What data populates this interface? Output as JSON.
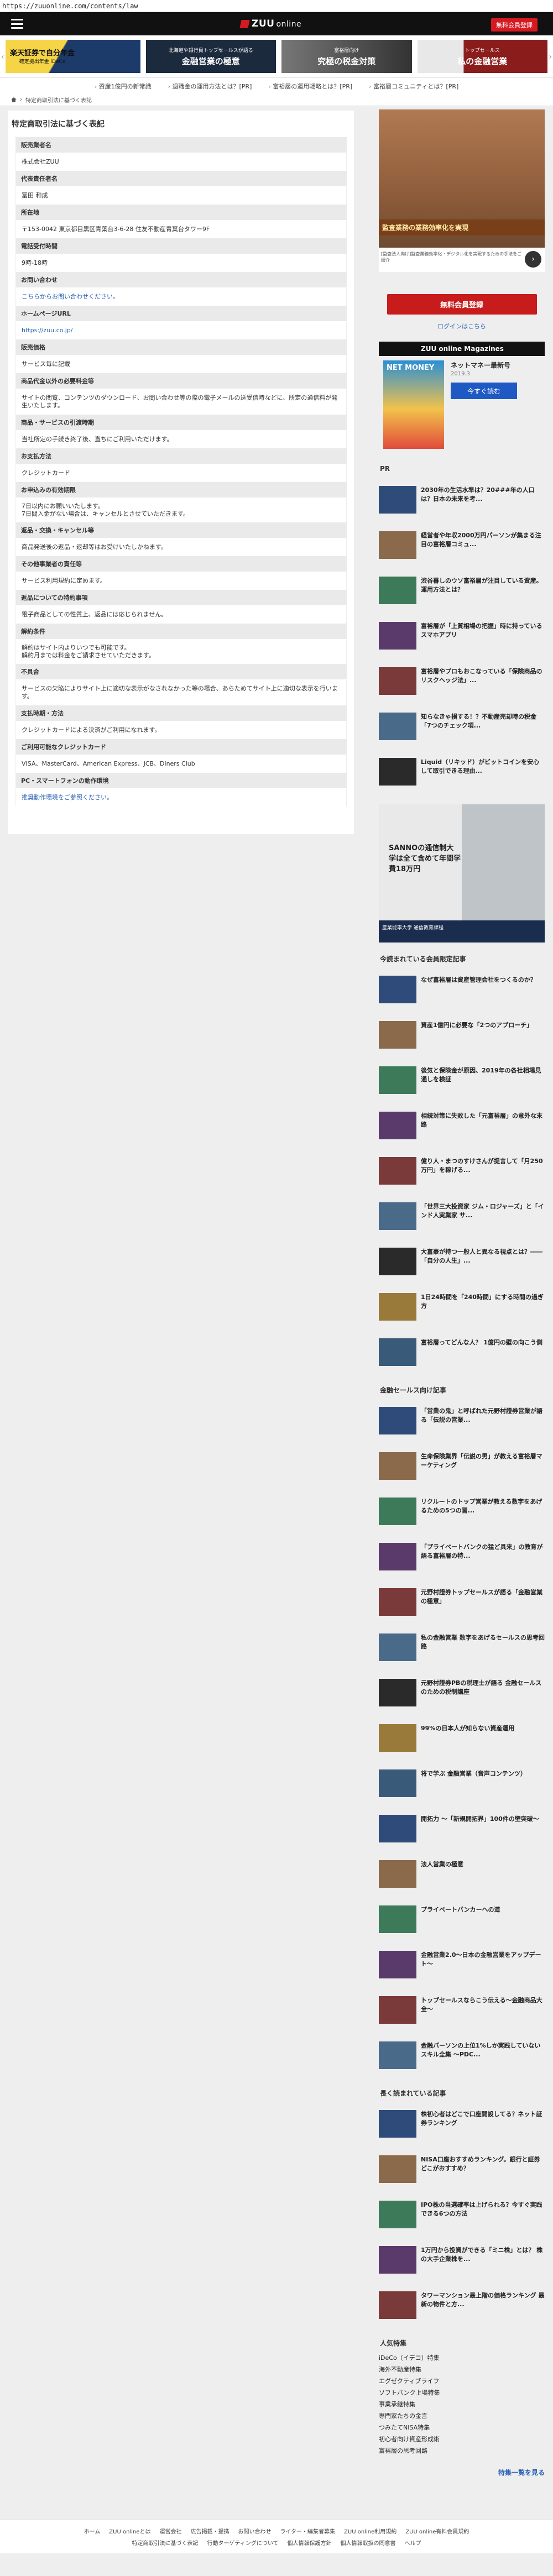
{
  "browser": {
    "url": "https://zuuonline.com/contents/law"
  },
  "header": {
    "logo": "ZUU",
    "logo_sub": "online",
    "signup": "無料会員登録"
  },
  "banners": [
    {
      "title": "楽天証券で自分年金",
      "sub": "確定拠出年金 iDeCo"
    },
    {
      "title": "金融営業の極意",
      "sub": "北海道や銀行員トップセールスが語る"
    },
    {
      "title": "究極の税金対策",
      "sub": "富裕層向け"
    },
    {
      "title": "私の金融営業",
      "sub": "トップセールス"
    }
  ],
  "ad_links": [
    "資産1億円の新常識",
    "退職金の運用方法とは？[PR]",
    "富裕層の運用戦略とは？[PR]",
    "富裕層コミュニティとは？[PR]"
  ],
  "breadcrumb": {
    "current": "特定商取引法に基づく表記"
  },
  "page": {
    "title": "特定商取引法に基づく表記",
    "rows": [
      {
        "label": "販売業者名",
        "value": [
          "株式会社ZUU"
        ]
      },
      {
        "label": "代表責任者名",
        "value": [
          "冨田 和成"
        ]
      },
      {
        "label": "所在地",
        "value": [
          "〒153-0042 東京都目黒区青葉台3-6-28 住友不動産青葉台タワー9F"
        ]
      },
      {
        "label": "電話受付時間",
        "value": [
          "9時-18時"
        ]
      },
      {
        "label": "お問い合わせ",
        "value": [
          "こちらからお問い合わせください。"
        ],
        "link": true
      },
      {
        "label": "ホームページURL",
        "value": [
          "https://zuu.co.jp/"
        ],
        "link": true
      },
      {
        "label": "販売価格",
        "value": [
          "サービス毎に記載"
        ]
      },
      {
        "label": "商品代金以外の必要料金等",
        "value": [
          "サイトの閲覧、コンテンツのダウンロード、お問い合わせ等の際の電子メールの送受信時などに、所定の通信料が発生いたします。"
        ]
      },
      {
        "label": "商品・サービスの引渡時期",
        "value": [
          "当社所定の手続き終了後、直ちにご利用いただけます。"
        ]
      },
      {
        "label": "お支払方法",
        "value": [
          "クレジットカード"
        ]
      },
      {
        "label": "お申込みの有効期限",
        "value": [
          "7日以内にお願いいたします。",
          "7日間入金がない場合は、キャンセルとさせていただきます。"
        ]
      },
      {
        "label": "返品・交換・キャンセル等",
        "value": [
          "商品発送後の返品・返却等はお受けいたしかねます。"
        ]
      },
      {
        "label": "その他事業者の責任等",
        "value": [
          "サービス利用規約に定めます。"
        ]
      },
      {
        "label": "返品についての特約事項",
        "value": [
          "電子商品としての性質上、返品には応じられません。"
        ]
      },
      {
        "label": "解約条件",
        "value": [
          "解約はサイト内よりいつでも可能です。",
          "解約月までは料金をご請求させていただきます。"
        ]
      },
      {
        "label": "不具合",
        "value": [
          "サービスの欠陥によりサイト上に適切な表示がなされなかった等の場合、あらためてサイト上に適切な表示を行います。"
        ]
      },
      {
        "label": "支払時期・方法",
        "value": [
          "クレジットカードによる決済がご利用になれます。"
        ]
      },
      {
        "label": "ご利用可能なクレジットカード",
        "value": [
          "VISA、MasterCard、American Express、JCB、Diners Club"
        ]
      },
      {
        "label": "PC・スマートフォンの動作環境",
        "value": [
          "推奨動作環境をご参照ください。"
        ],
        "link": true
      }
    ]
  },
  "sidebar": {
    "ad": {
      "caption": "監査業務の業務効率化を実現",
      "under": "[監査法人向け]監査業務効率化・デジタル化を実現するための手法をご紹介"
    },
    "free_signup": "無料会員登録",
    "login": "ログインはこちら",
    "magazines_heading": "ZUU online Magazines",
    "magazine": {
      "title": "ネットマネー最新号",
      "date": "2019.3",
      "cover": "NET MONEY",
      "button": "今すぐ読む"
    },
    "pr_heading": "PR",
    "pr_items": [
      "2030年の生活水準は？20###年の人口は？日本の未来を考...",
      "経営者や年収2000万円パーソンが集まる注目の富裕層コミュ...",
      "渋谷暮しのウソ富裕層が注目している資産。運用方法とは？",
      "富裕層が「上質相場の把握」時に持っているスマホアプリ",
      "富裕層やプロもおこなっている「保険商品のリスクヘッジ法」...",
      "知らなきゃ損する！？不動産売却時の税金「7つのチェック項...",
      "Liquid（リキッド）がビットコインを安心して取引できる理由..."
    ],
    "mid_ad": {
      "caption": "SANNOの通信制大学は全て含めて年間学費18万円",
      "bar": "産業能率大学 通信教育課程"
    },
    "popular_heading": "今読まれている会員限定記事",
    "popular_items": [
      "なぜ富裕層は資産管理会社をつくるのか？",
      "資産1億円に必要な「2つのアプローチ」",
      "後気と保険金が原因、2019年の各社相場見通しを検証",
      "相続対策に失敗した「元富裕層」の意外な末路",
      "億り人・まつのすけさんが提言して「月250万円」を稼げる...",
      "「世界三大投資家 ジム・ロジャーズ」と「インド人実業家 サ...",
      "大富豪が持つ一般人と異なる視点とは？――「自分の人生」...",
      "1日24時間を「240時間」にする時間の過ぎ方",
      "富裕層ってどんな人？ 1億円の壁の向こう側"
    ],
    "sales_heading": "金融セールス向け記事",
    "sales_items": [
      "「営業の鬼」と呼ばれた元野村證券営業が語る「伝説の営業...",
      "生命保険業界「伝説の男」が教える富裕層マーケティング",
      "リクルートのトップ営業が教える数字をあげるための5つの習...",
      "「プライベートバンクの猛ど具来」の教育が語る富裕層の特...",
      "元野村證券トップセールスが語る「金融営業の極意」",
      "私の金融営業 数字をあげるセールスの思考回路",
      "元野村證券PBの税理士が語る 金融セールスのための税制講座",
      "99%の日本人が知らない資産運用",
      "将で学ぶ 金融営業（音声コンテンツ）",
      "開拓力 ～「新規開拓界」100件の壁突破～",
      "法人営業の極意",
      "プライベートバンカーへの道",
      "金融営業2.0～日本の金融営業をアップデート～",
      "トップセールスならこう伝える～金融商品大全～",
      "金融パーソンの上位1%しか実践していないスキル全集 ～PDC..."
    ],
    "long_heading": "長く読まれている記事",
    "long_items": [
      "株初心者はどこで口座開設してる？ネット証券ランキング",
      "NISA口座おすすめランキング。銀行と証券どこがおすすめ？",
      "IPO株の当選確率は上げられる？今すぐ実践できる6つの方法",
      "1万円から投資ができる「ミニ株」とは？ 株の大手企業株を...",
      "タワーマンション最上階の価格ランキング 最新の物件と方..."
    ],
    "tags_heading": "人気特集",
    "tags": [
      "iDeCo（イデコ）特集",
      "海外不動産特集",
      "エグゼクティブライフ",
      "ソフトバンク上場特集",
      "事業承継特集",
      "専門家たちの金言",
      "つみたてNISA特集",
      "初心者向け資産形成術",
      "富裕層の思考回路"
    ],
    "more": "特集一覧を見る"
  },
  "footer": {
    "row1": [
      "ホーム",
      "ZUU onlineとは",
      "運営会社",
      "広告掲載・提携",
      "お問い合わせ",
      "ライター・編集者募集",
      "ZUU online利用規約",
      "ZUU online有料会員規約"
    ],
    "row2": [
      "特定商取引法に基づく表記",
      "行動ターゲティングについて",
      "個人情報保護方針",
      "個人情報取扱の同意書",
      "ヘルプ"
    ]
  },
  "colors": {
    "accent": "#d71920",
    "link": "#2a62b3",
    "dark": "#111111"
  }
}
